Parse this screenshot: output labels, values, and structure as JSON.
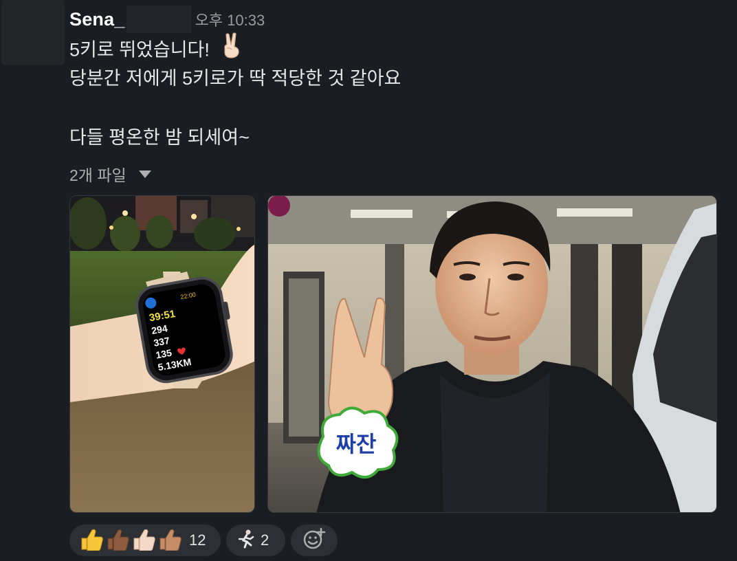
{
  "message": {
    "sender": "Sena_",
    "timestamp": "오후 10:33",
    "lines": [
      "5키로 뛰었습니다!",
      "당분간 저에게 5키로가 딱 적당한 것 같아요",
      "다들 평온한 밤 되세여~"
    ],
    "line1_emoji": "victory-hand-emoji"
  },
  "files": {
    "toggle_label": "2개 파일"
  },
  "attachments": [
    {
      "name": "apple-watch-workout-photo",
      "watch": {
        "time": "22:00",
        "duration": "39:51",
        "metric1": "294",
        "metric2": "337",
        "heart_rate": "135",
        "distance": "5.13KM"
      }
    },
    {
      "name": "victory-sign-meme-photo",
      "caption": "짜잔"
    }
  ],
  "reactions": [
    {
      "emoji": "thumbs-up-multi-skin-tone",
      "count": "12"
    },
    {
      "emoji": "runner",
      "count": "2"
    },
    {
      "emoji": "add-reaction"
    }
  ],
  "colors": {
    "background": "#1a1d21",
    "text": "#e6e7e8",
    "muted": "#9a9b9d",
    "reaction_bg": "#2c2f33"
  }
}
